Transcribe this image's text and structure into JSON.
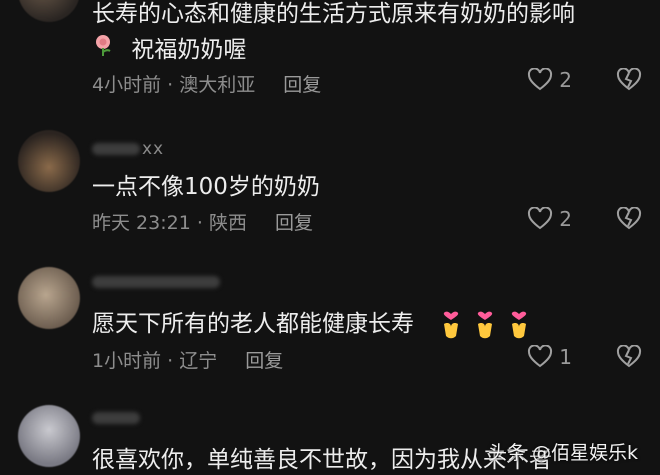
{
  "comments": [
    {
      "text_line1": "长寿的心态和健康的生活方式原来有奶奶的影响",
      "text_line2": "祝福奶奶喔",
      "time": "4小时前",
      "location": "澳大利亚",
      "reply_label": "回复",
      "likes": "2"
    },
    {
      "username": "xx",
      "text": "一点不像100岁的奶奶",
      "time": "昨天 23:21",
      "location": "陕西",
      "reply_label": "回复",
      "likes": "2"
    },
    {
      "text": "愿天下所有的老人都能健康长寿",
      "time": "1小时前",
      "location": "辽宁",
      "reply_label": "回复",
      "likes": "1"
    },
    {
      "text": "很喜欢你，单纯善良不世故，因为我从来不者"
    }
  ],
  "meta_separator": "·",
  "watermark": "头条 @佰星娱乐k",
  "icons": {
    "like": "heart-outline-icon",
    "dislike": "broken-heart-icon",
    "rose": "rose-emoji",
    "heart_hand": "heart-hands-emoji"
  }
}
